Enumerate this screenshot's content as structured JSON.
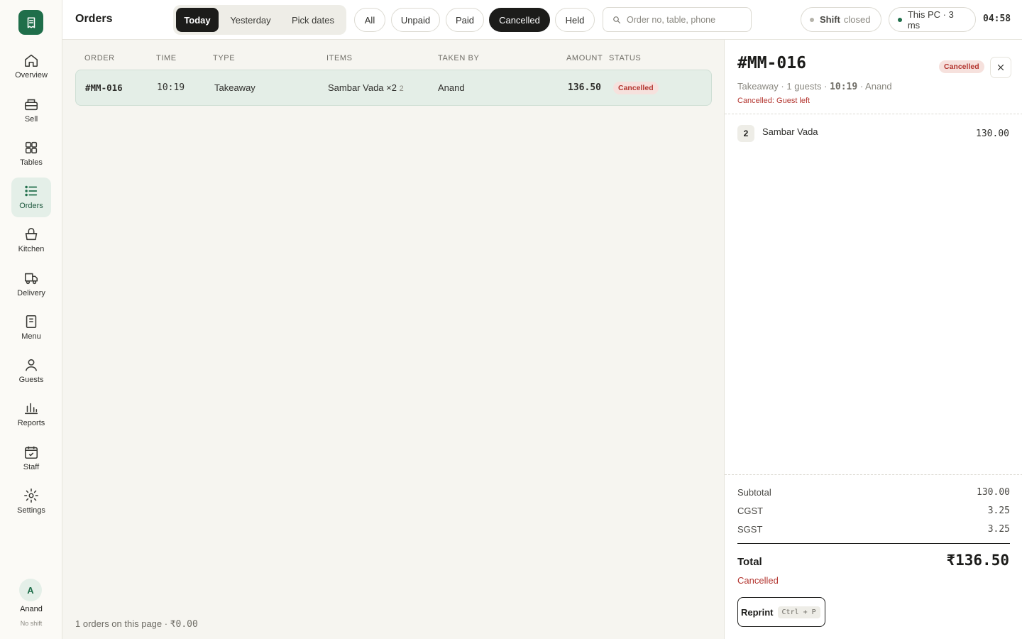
{
  "app": {
    "title": "Orders"
  },
  "sidebar": {
    "items": [
      {
        "label": "Overview",
        "icon": "home-icon"
      },
      {
        "label": "Sell",
        "icon": "register-icon"
      },
      {
        "label": "Tables",
        "icon": "grid-icon"
      },
      {
        "label": "Orders",
        "icon": "list-icon",
        "active": true
      },
      {
        "label": "Kitchen",
        "icon": "basket-icon"
      },
      {
        "label": "Delivery",
        "icon": "truck-icon"
      },
      {
        "label": "Menu",
        "icon": "menu-doc-icon"
      },
      {
        "label": "Guests",
        "icon": "user-icon"
      },
      {
        "label": "Reports",
        "icon": "bar-chart-icon"
      },
      {
        "label": "Staff",
        "icon": "calendar-check-icon"
      },
      {
        "label": "Settings",
        "icon": "gear-icon"
      }
    ],
    "user": {
      "initial": "A",
      "name": "Anand",
      "shift": "No shift"
    }
  },
  "topbar": {
    "date_tabs": [
      "Today",
      "Yesterday",
      "Pick dates"
    ],
    "date_active": "Today",
    "filters": [
      "All",
      "Unpaid",
      "Paid",
      "Cancelled",
      "Held"
    ],
    "filter_active": "Cancelled",
    "search_placeholder": "Order no, table, phone",
    "shift": {
      "label": "Shift",
      "status": "closed"
    },
    "connection": "This PC · 3 ms",
    "clock": "04:58"
  },
  "orders": {
    "columns": [
      "ORDER",
      "TIME",
      "TYPE",
      "ITEMS",
      "TAKEN BY",
      "AMOUNT",
      "STATUS"
    ],
    "rows": [
      {
        "order": "#MM-016",
        "time": "10:19",
        "type": "Takeaway",
        "items": "Sambar Vada ×2",
        "items_count": "2",
        "taken_by": "Anand",
        "amount": "136.50",
        "status": "Cancelled"
      }
    ],
    "footer_text": "1 orders on this page · ",
    "footer_amount": "₹0.00"
  },
  "detail": {
    "order_no": "#MM-016",
    "status": "Cancelled",
    "meta_prefix": "Takeaway · 1 guests · ",
    "meta_time": "10:19",
    "meta_suffix": " · Anand",
    "reason": "Cancelled: Guest left",
    "line_items": [
      {
        "qty": "2",
        "name": "Sambar Vada",
        "amount": "130.00"
      }
    ],
    "summary": [
      {
        "label": "Subtotal",
        "value": "130.00"
      },
      {
        "label": "CGST",
        "value": "3.25"
      },
      {
        "label": "SGST",
        "value": "3.25"
      }
    ],
    "total_label": "Total",
    "total_value": "₹136.50",
    "status_text": "Cancelled",
    "reprint_label": "Reprint",
    "reprint_shortcut": "Ctrl + P"
  },
  "colors": {
    "accent": "#1f6e4a",
    "danger": "#b3352f",
    "dark": "#1c1c1a"
  }
}
